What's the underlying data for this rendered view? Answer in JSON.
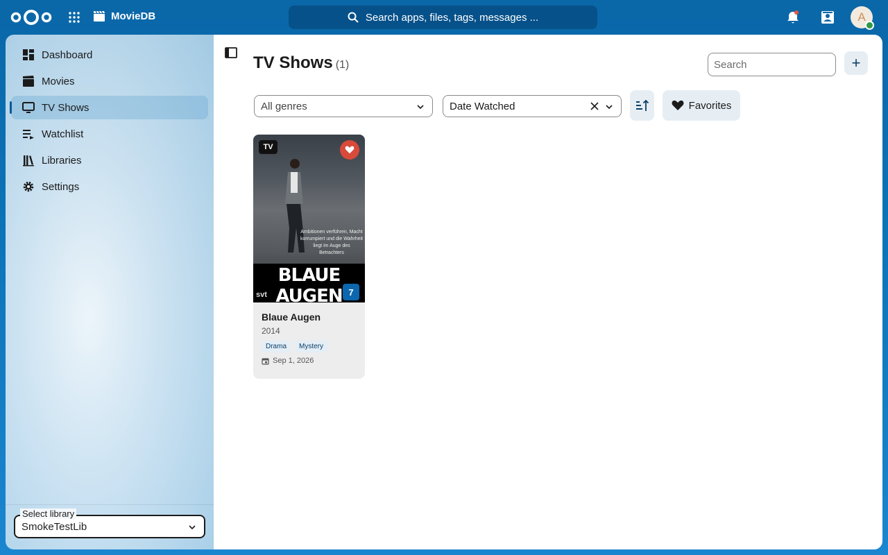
{
  "header": {
    "app_name": "MovieDB",
    "search_placeholder": "Search apps, files, tags, messages ...",
    "avatar_initial": "A"
  },
  "sidebar": {
    "items": [
      {
        "label": "Dashboard",
        "icon": "dashboard-icon"
      },
      {
        "label": "Movies",
        "icon": "clapperboard-icon"
      },
      {
        "label": "TV Shows",
        "icon": "television-icon",
        "active": true
      },
      {
        "label": "Watchlist",
        "icon": "playlist-icon"
      },
      {
        "label": "Libraries",
        "icon": "library-icon"
      },
      {
        "label": "Settings",
        "icon": "gear-icon"
      }
    ],
    "library_select": {
      "label": "Select library",
      "value": "SmokeTestLib"
    }
  },
  "main": {
    "title": "TV Shows",
    "count": "(1)",
    "search_placeholder": "Search",
    "add_label": "+",
    "genre_filter": "All genres",
    "sort_field": "Date Watched",
    "favorites_label": "Favorites"
  },
  "cards": [
    {
      "type_badge": "TV",
      "poster_title": "BLAUE AUGEN",
      "poster_tagline": "Ambitionen verführen, Macht korrumpiert und die Wahrheit liegt im Auge des Betrachters",
      "poster_logo": "svt",
      "count": "7",
      "title": "Blaue Augen",
      "year": "2014",
      "genres": [
        "Drama",
        "Mystery"
      ],
      "watched_date": "Sep 1, 2026",
      "favorite": true
    }
  ],
  "colors": {
    "accent": "#0c67ae",
    "favorite": "#d84a3a"
  }
}
